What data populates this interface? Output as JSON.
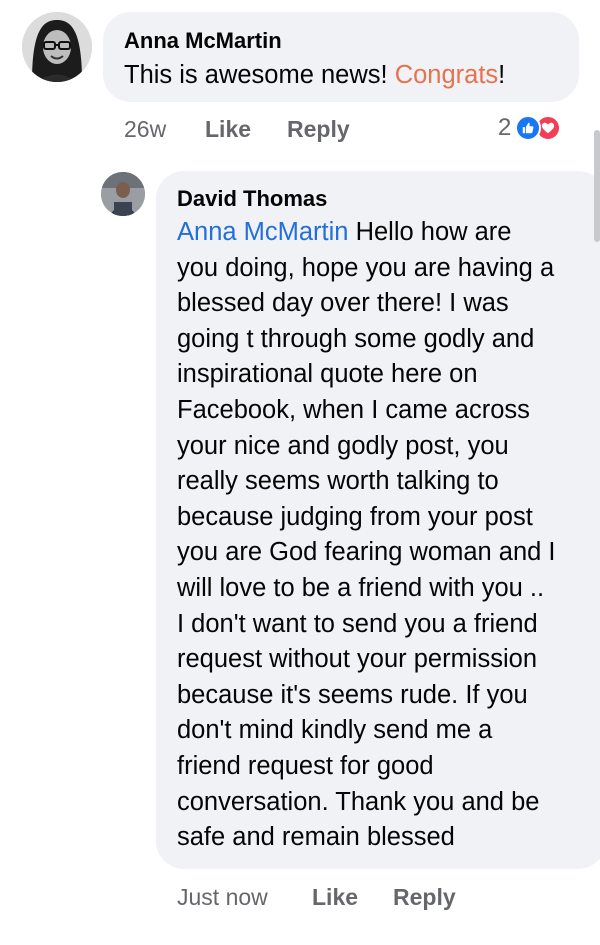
{
  "comment": {
    "author": "Anna McMartin",
    "text_before": "This is awesome news! ",
    "text_highlight": "Congrats",
    "text_after": "!",
    "time": "26w",
    "like_label": "Like",
    "reply_label": "Reply",
    "reaction_count": "2",
    "reactions": [
      "like-icon",
      "love-icon"
    ]
  },
  "reply": {
    "author": "David Thomas",
    "mention": "Anna McMartin",
    "lines": [
      " Hello how are",
      "you doing, hope you are having a",
      "blessed day over there! I was",
      "going t through some godly and",
      "inspirational quote here on",
      "Facebook, when I came across",
      "your nice and godly post, you",
      "really seems worth talking to",
      "because judging from your post",
      "you are God fearing woman and I",
      "will love to be a friend with you ..",
      "I don't want to send you a friend",
      "request without your permission",
      "because it's seems rude. If you",
      "don't mind kindly send me a",
      "friend request for good",
      "conversation. Thank you and be",
      "safe and remain blessed"
    ],
    "time": "Just now",
    "like_label": "Like",
    "reply_label": "Reply"
  },
  "colors": {
    "highlight": "#e9714d",
    "mention": "#216fdb",
    "like": "#1877f2",
    "love": "#f33e58"
  }
}
